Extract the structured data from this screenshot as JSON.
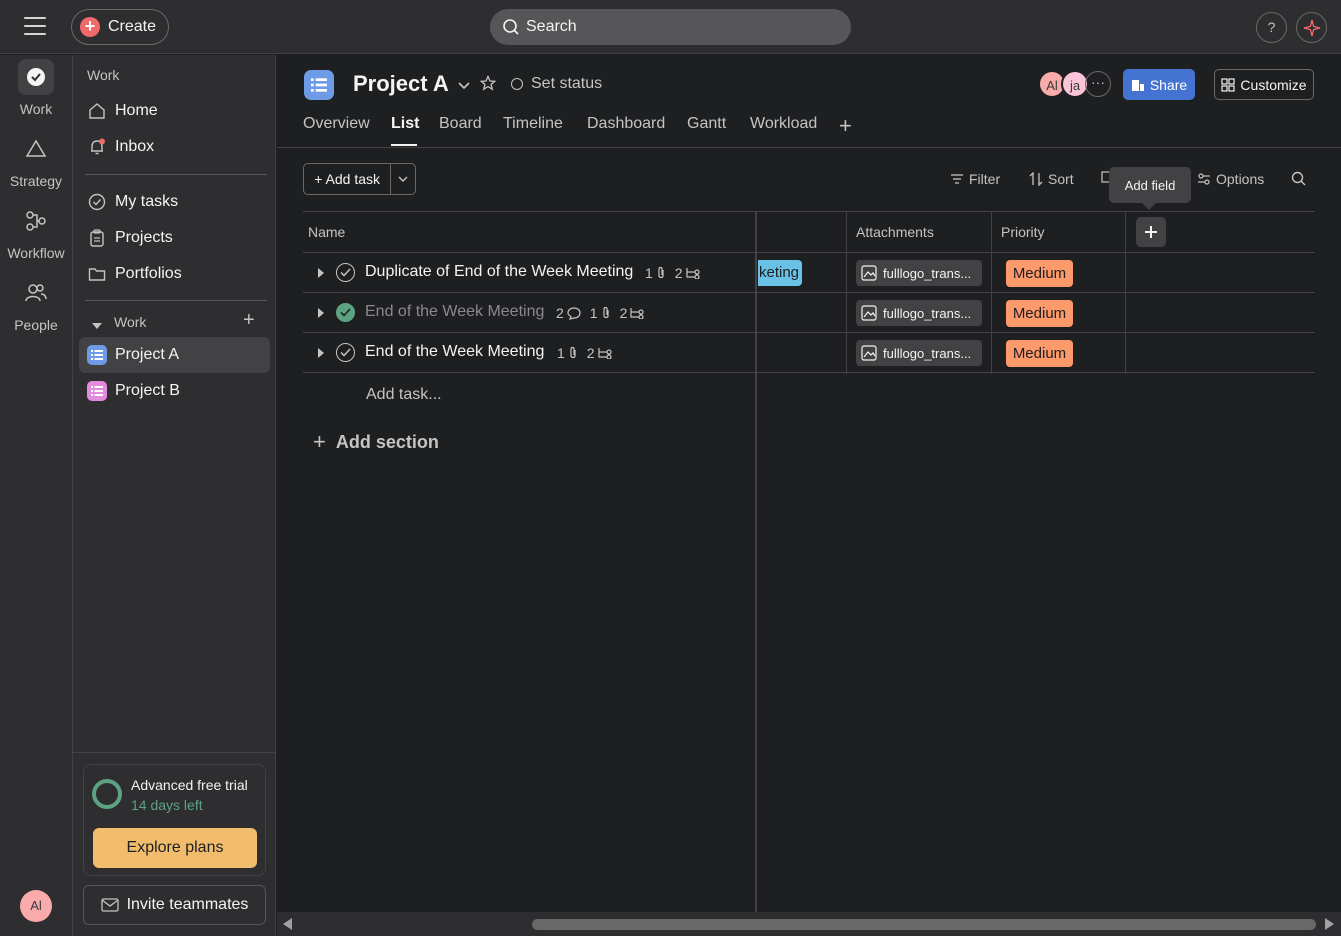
{
  "topbar": {
    "create_label": "Create",
    "search_placeholder": "Search",
    "help_label": "?"
  },
  "rail": {
    "items": [
      {
        "label": "Work",
        "icon": "check-circle-icon"
      },
      {
        "label": "Strategy",
        "icon": "triangle-icon"
      },
      {
        "label": "Workflow",
        "icon": "workflow-icon"
      },
      {
        "label": "People",
        "icon": "people-icon"
      }
    ],
    "user_initials": "Al"
  },
  "sidebar": {
    "section_title": "Work",
    "nav": [
      {
        "label": "Home",
        "icon": "home-icon"
      },
      {
        "label": "Inbox",
        "icon": "bell-icon"
      }
    ],
    "nav2": [
      {
        "label": "My tasks",
        "icon": "check-circle-icon"
      },
      {
        "label": "Projects",
        "icon": "clipboard-icon"
      },
      {
        "label": "Portfolios",
        "icon": "folder-icon"
      }
    ],
    "projects_heading": "Work",
    "projects": [
      {
        "label": "Project A",
        "color": "#6d9be6",
        "active": true
      },
      {
        "label": "Project B",
        "color": "#e48be0",
        "active": false
      }
    ],
    "trial": {
      "title": "Advanced free trial",
      "subtitle": "14 days left",
      "button": "Explore plans"
    },
    "invite_label": "Invite teammates"
  },
  "project": {
    "title": "Project A",
    "status_label": "Set status",
    "members": [
      "Al",
      "ja"
    ],
    "more_label": "···",
    "share_label": "Share",
    "customize_label": "Customize",
    "tabs": [
      "Overview",
      "List",
      "Board",
      "Timeline",
      "Dashboard",
      "Gantt",
      "Workload"
    ],
    "active_tab": "List"
  },
  "toolbar": {
    "add_task_label": "Add task",
    "filter_label": "Filter",
    "sort_label": "Sort",
    "options_label": "Options",
    "tooltip": "Add field"
  },
  "table": {
    "columns": [
      "Name",
      "Attachments",
      "Priority"
    ],
    "rows": [
      {
        "name": "Duplicate of End of the Week Meeting",
        "done": false,
        "comments": "",
        "attachments": "1",
        "subtasks": "2",
        "tag": "keting",
        "attachment_file": "fulllogo_trans...",
        "priority": "Medium"
      },
      {
        "name": "End of the Week Meeting",
        "done": true,
        "comments": "2",
        "attachments": "1",
        "subtasks": "2",
        "tag": "",
        "attachment_file": "fulllogo_trans...",
        "priority": "Medium"
      },
      {
        "name": "End of the Week Meeting",
        "done": false,
        "comments": "",
        "attachments": "1",
        "subtasks": "2",
        "tag": "",
        "attachment_file": "fulllogo_trans...",
        "priority": "Medium"
      }
    ],
    "add_task_inline": "Add task...",
    "add_section": "Add section"
  },
  "colors": {
    "accent": "#4573d2",
    "priority_medium": "#fc9a6c",
    "tag": "#6ac1e6",
    "trial": "#5da283",
    "explore": "#f1bd6c"
  }
}
